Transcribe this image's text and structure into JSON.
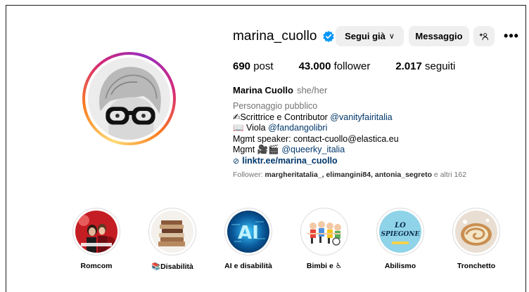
{
  "profile": {
    "username": "marina_cuollo",
    "follow_label": "Segui già",
    "follow_chevron": "∨",
    "message_label": "Messaggio",
    "add_user_label": "+⚲",
    "more_label": "•••",
    "stats": {
      "posts_count": "690",
      "posts_label": " post",
      "followers_count": "43.000",
      "followers_label": " follower",
      "following_count": "2.017",
      "following_label": " seguiti"
    },
    "full_name": "Marina Cuollo",
    "pronouns": "she/her",
    "bio": {
      "category": "Personaggio pubblico",
      "line1_prefix": "✍Scrittrice e Contributor ",
      "line1_mention": "@vanityfairitalia",
      "line2_prefix": "📖 Viola ",
      "line2_mention": "@fandangolibri",
      "line3": "Mgmt speaker: contact-cuollo@elastica.eu",
      "line4_prefix": "Mgmt 🎥🎬 ",
      "line4_mention": "@queerky_italia",
      "link_icon": "⊘",
      "link": "linktr.ee/marina_cuollo"
    },
    "followed_by": {
      "prefix": "Follower: ",
      "names": "margheritatalia_, elimangini84, antonia_segreto",
      "suffix": " e altri 162"
    }
  },
  "highlights": [
    {
      "label": "Romcom"
    },
    {
      "label": "📚Disabilità"
    },
    {
      "label": "AI e disabilità",
      "image_text": "AI"
    },
    {
      "label": "Bimbi e ♿"
    },
    {
      "label": "Abilismo",
      "image_text_1": "LO",
      "image_text_2": "SPIEGONE"
    },
    {
      "label": "Tronchetto"
    }
  ],
  "colors": {
    "link": "#00376b",
    "secondary_text": "#737373",
    "button_bg": "#efefef",
    "verified": "#0095f6"
  }
}
